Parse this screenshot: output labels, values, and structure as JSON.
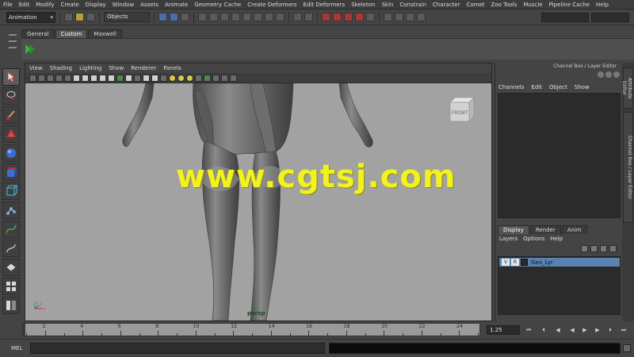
{
  "menubar": [
    "File",
    "Edit",
    "Modify",
    "Create",
    "Display",
    "Window",
    "Assets",
    "Animate",
    "Geometry Cache",
    "Create Deformers",
    "Edit Deformers",
    "Skeleton",
    "Skin",
    "Constrain",
    "Character",
    "Comet",
    "Zoo Tools",
    "Muscle",
    "Pipeline Cache",
    "Help"
  ],
  "status": {
    "mode": "Animation",
    "selection_mask": "Objects"
  },
  "shelf": {
    "tabs": [
      "General",
      "Custom",
      "Maxwell"
    ],
    "active_tab": "Custom"
  },
  "viewport": {
    "menu": [
      "View",
      "Shading",
      "Lighting",
      "Show",
      "Renderer",
      "Panels"
    ],
    "camera_label": "persp",
    "viewcube_face": "FRONT",
    "watermark": "www.cgtsj.com",
    "axis": {
      "x": "x",
      "y": "y",
      "z": "z"
    }
  },
  "channel_box": {
    "title": "Channel Box / Layer Editor",
    "menu": [
      "Channels",
      "Edit",
      "Object",
      "Show"
    ]
  },
  "layer_editor": {
    "tabs": [
      "Display",
      "Render",
      "Anim"
    ],
    "active_tab": "Display",
    "menu": [
      "Layers",
      "Options",
      "Help"
    ],
    "layers": [
      {
        "v": "V",
        "r": "R",
        "name": "Geo_Lyr"
      }
    ]
  },
  "side_tabs": [
    "Attribute Editor",
    "Channel Box / Layer Editor"
  ],
  "timeline": {
    "labels": [
      "2",
      "4",
      "6",
      "8",
      "10",
      "12",
      "14",
      "16",
      "18",
      "20",
      "22",
      "24"
    ],
    "current_frame": "1.25"
  },
  "command_line": {
    "label": "MEL"
  },
  "colors": {
    "viewport_bg": "#a2a2a2",
    "watermark": "#f2f220",
    "layer_highlight": "#5a82b0"
  }
}
